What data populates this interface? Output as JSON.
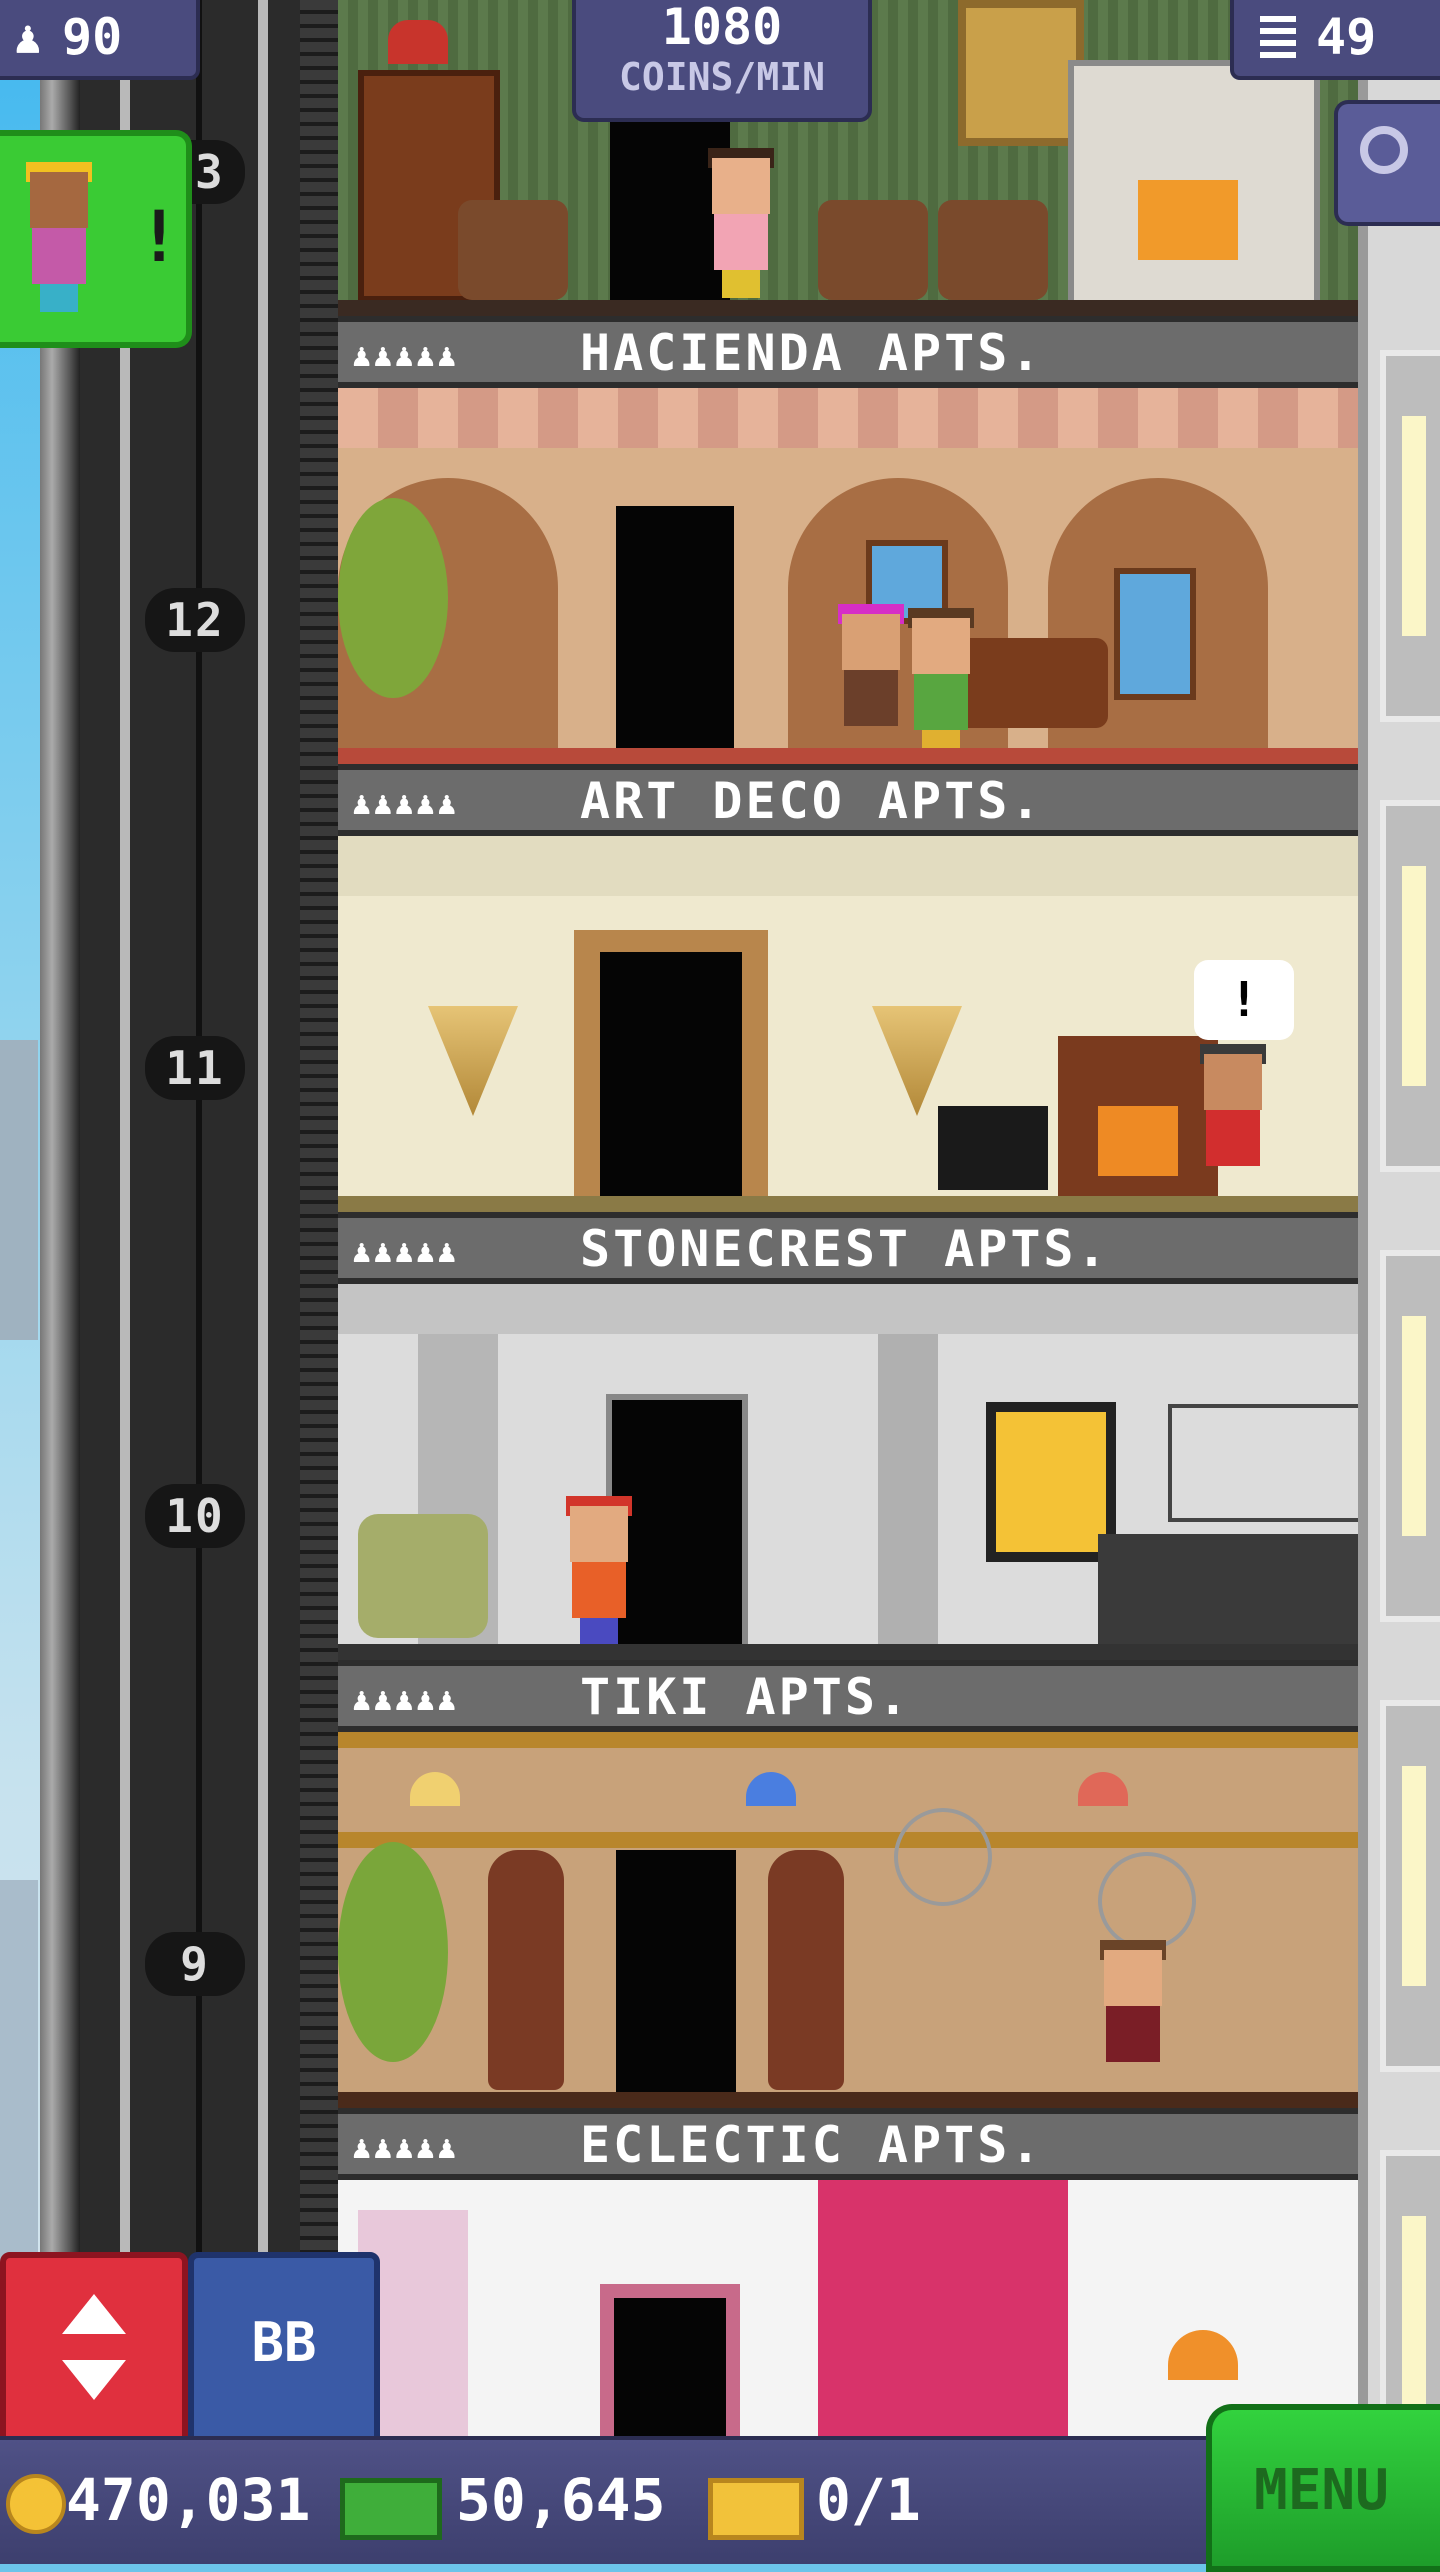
{
  "hud": {
    "population": "90",
    "coins_per_min_value": "1080",
    "coins_per_min_unit": "COINS/MIN",
    "floors": "49"
  },
  "visitor_alert": "!",
  "elevator_floor_numbers": [
    "13",
    "12",
    "11",
    "10",
    "9"
  ],
  "floors": [
    {
      "name": "HACIENDA APTS.",
      "people": "♟♟♟♟♟"
    },
    {
      "name": "ART DECO APTS.",
      "people": "♟♟♟♟♟"
    },
    {
      "name": "STONECREST APTS.",
      "people": "♟♟♟♟♟"
    },
    {
      "name": "TIKI APTS.",
      "people": "♟♟♟♟♟"
    },
    {
      "name": "ECLECTIC APTS.",
      "people": "♟♟♟♟♟"
    }
  ],
  "speech_bubble": "!",
  "buttons": {
    "bb": "BB",
    "menu": "MENU"
  },
  "currency": {
    "coins": "470,031",
    "bux": "50,645",
    "tickets": "0/1"
  },
  "colors": {
    "hud_bg": "#4a4b7e",
    "menu_green": "#32d23e",
    "elevator_red": "#e0303e",
    "bb_blue": "#3a5aa6"
  }
}
